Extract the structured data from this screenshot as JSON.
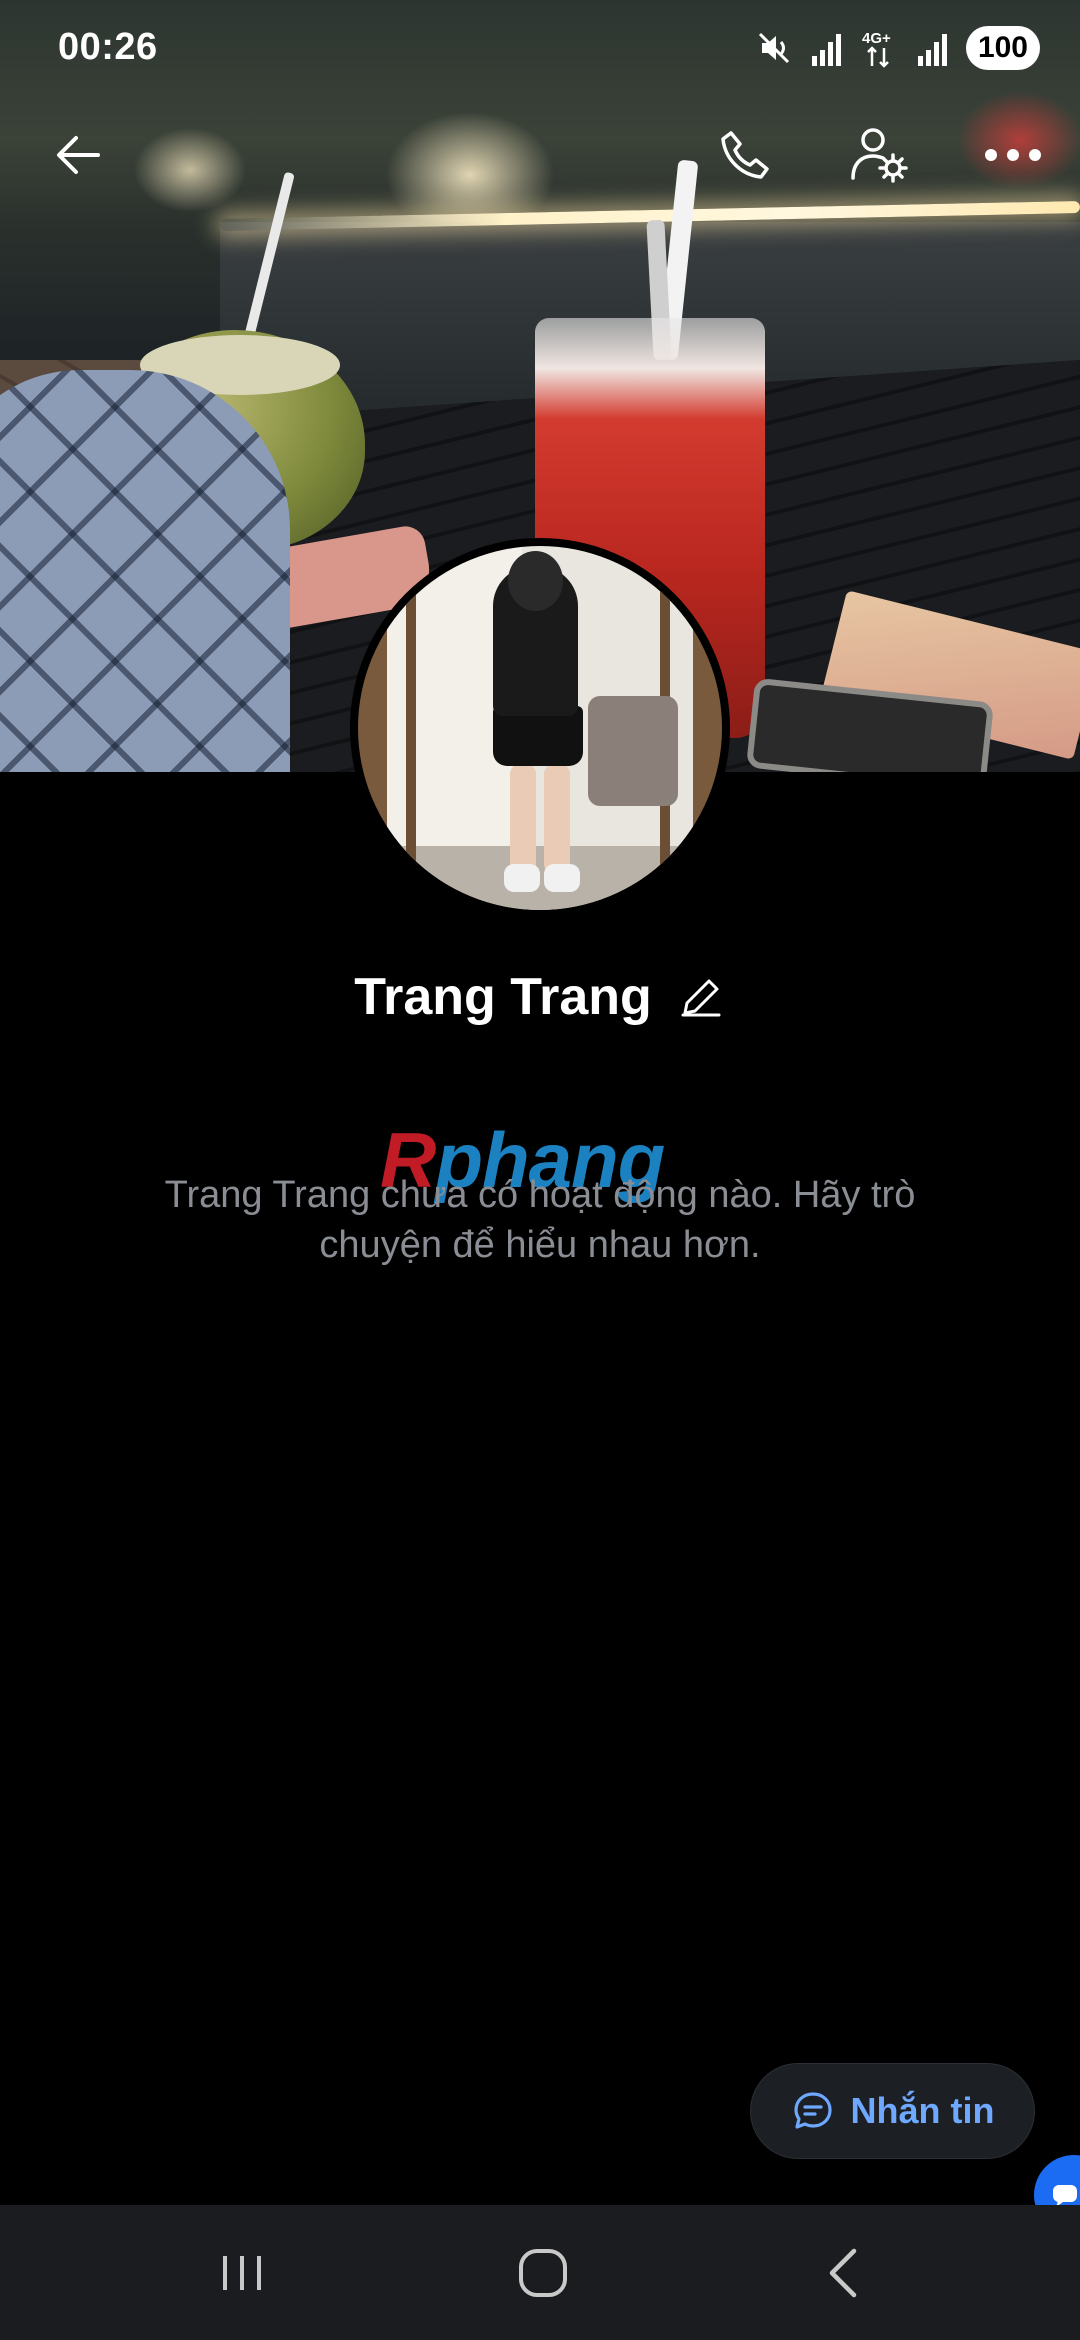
{
  "status_bar": {
    "time": "00:26",
    "network": "4G+",
    "battery": "100"
  },
  "top_actions": {
    "back_icon": "arrow-left-icon",
    "call_icon": "phone-icon",
    "settings_icon": "user-settings-icon",
    "more_icon": "more-horizontal-icon"
  },
  "profile": {
    "name": "Trang Trang",
    "edit_icon": "pencil-icon",
    "empty_message": "Trang Trang chưa có hoạt động nào. Hãy trò chuyện để hiểu nhau hơn."
  },
  "watermark": {
    "part1": "R",
    "part2": "phang"
  },
  "actions": {
    "message_label": "Nhắn tin",
    "message_icon": "chat-bubble-icon"
  },
  "nav": {
    "recents_icon": "recents-icon",
    "home_icon": "home-icon",
    "back_icon": "back-chevron-icon"
  },
  "colors": {
    "background": "#000000",
    "accent": "#6ea8ff",
    "nav_bar": "#1b1c1f",
    "muted_text": "#8a8d93"
  }
}
